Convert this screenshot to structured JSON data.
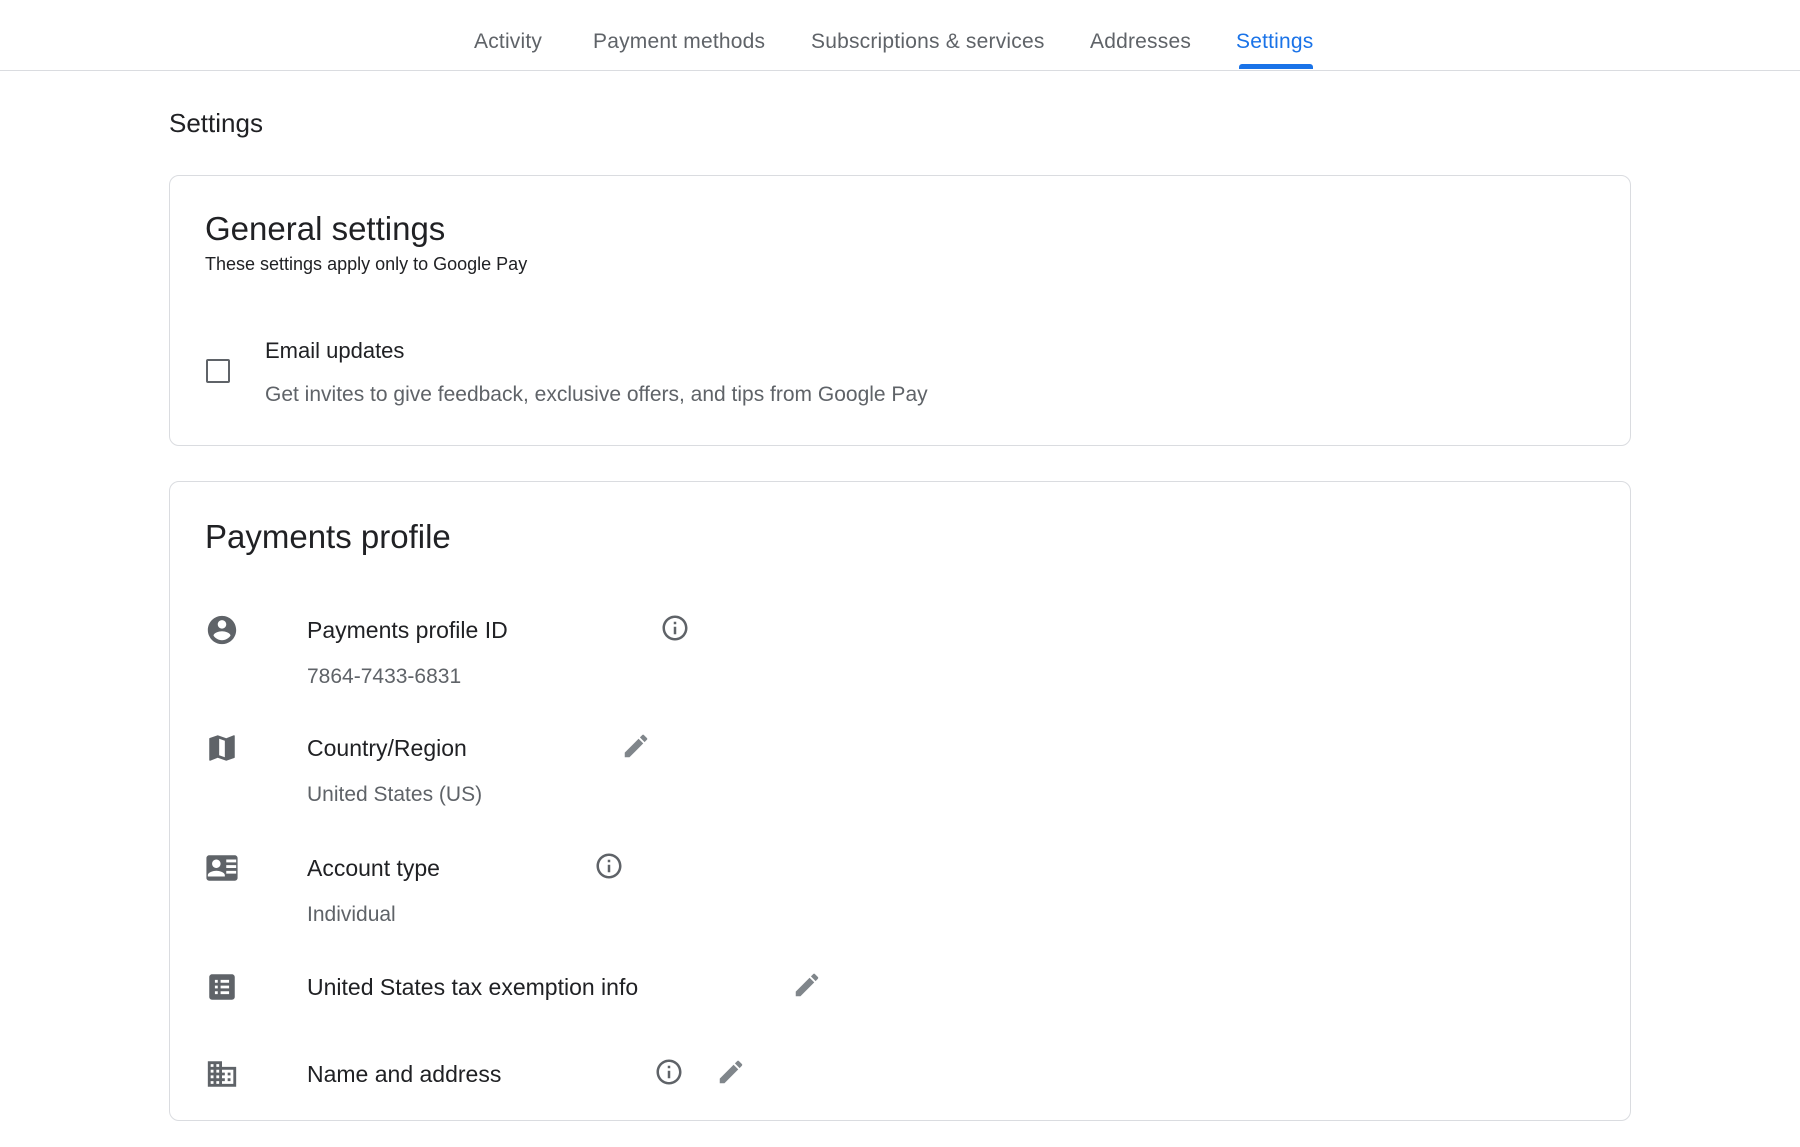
{
  "nav": {
    "tabs": [
      {
        "label": "Activity"
      },
      {
        "label": "Payment methods"
      },
      {
        "label": "Subscriptions & services"
      },
      {
        "label": "Addresses"
      },
      {
        "label": "Settings",
        "active": true
      }
    ]
  },
  "page": {
    "title": "Settings"
  },
  "general": {
    "title": "General settings",
    "subtitle": "These settings apply only to Google Pay",
    "email_updates": {
      "label": "Email updates",
      "description": "Get invites to give feedback, exclusive offers, and tips from Google Pay",
      "checked": false
    }
  },
  "profile": {
    "title": "Payments profile",
    "items": [
      {
        "label": "Payments profile ID",
        "value": "7864-7433-6831",
        "icon": "account-circle-icon",
        "action": "info-icon"
      },
      {
        "label": "Country/Region",
        "value": "United States (US)",
        "icon": "map-icon",
        "action": "edit-pencil-icon"
      },
      {
        "label": "Account type",
        "value": "Individual",
        "icon": "contact-card-icon",
        "action": "info-icon"
      },
      {
        "label": "United States tax exemption info",
        "value": "",
        "icon": "list-document-icon",
        "action": "edit-pencil-icon"
      },
      {
        "label": "Name and address",
        "value": "",
        "icon": "building-icon",
        "action": "info-icon",
        "action2": "edit-pencil-icon"
      }
    ]
  },
  "colors": {
    "accent": "#1a73e8",
    "text": "#202124",
    "secondary": "#5f6368",
    "border": "#dadce0"
  }
}
